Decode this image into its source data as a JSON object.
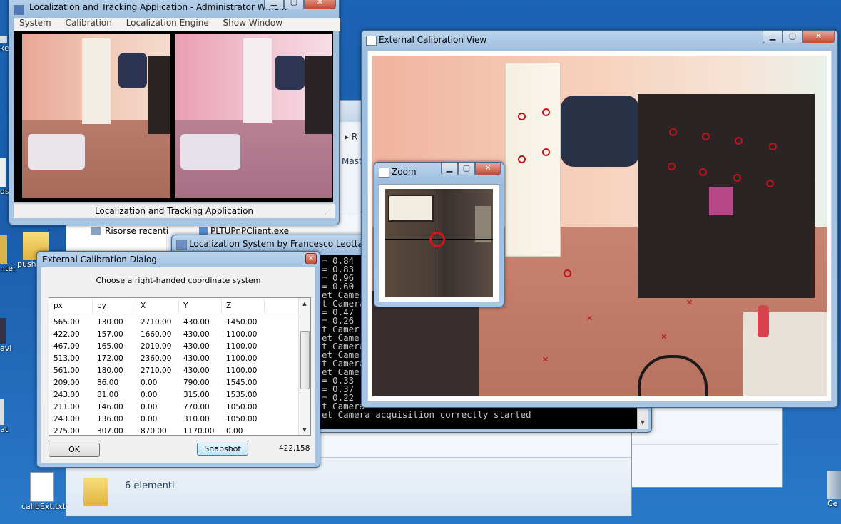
{
  "desktop": {
    "icons": [
      {
        "label": "ker"
      },
      {
        "label": "ds"
      },
      {
        "label": "nter"
      },
      {
        "label": "push"
      },
      {
        "label": "avi"
      },
      {
        "label": "at"
      },
      {
        "label": "calibExt.txt"
      },
      {
        "label": "Ce"
      }
    ]
  },
  "explorer": {
    "nav_item": "Risorse recenti",
    "file_item": "PLTUPnPClient.exe",
    "status_count": "6 elementi",
    "partial_labels": [
      "R",
      "Mast"
    ]
  },
  "main_window": {
    "title": "Localization and Tracking Application - Administrator Wind...",
    "menu": [
      "System",
      "Calibration",
      "Localization Engine",
      "Show Window"
    ],
    "status": "Localization and Tracking Application"
  },
  "console_window": {
    "title": "Localization System by Francesco Leotta 200",
    "lines": [
      "= 0.84",
      "= 0.83",
      "= 0.96",
      "= 0.60",
      "et Camer",
      "t Camera",
      "= 0.47",
      "= 0.26",
      "t Camer",
      "et Camer",
      "t Camera",
      "et Camer",
      "t Camera",
      "et Camer",
      "= 0.33",
      "= 0.37",
      "= 0.22",
      "t Camera",
      "et Camera acquisition correctly started"
    ]
  },
  "calib_view": {
    "title": "External Calibration View"
  },
  "zoom_window": {
    "title": "Zoom"
  },
  "dialog": {
    "title": "External Calibration Dialog",
    "instruction": "Choose a right-handed coordinate system",
    "columns": [
      "px",
      "py",
      "X",
      "Y",
      "Z"
    ],
    "rows": [
      [
        "565.00",
        "130.00",
        "2710.00",
        "430.00",
        "1450.00"
      ],
      [
        "422.00",
        "157.00",
        "1660.00",
        "430.00",
        "1100.00"
      ],
      [
        "467.00",
        "165.00",
        "2010.00",
        "430.00",
        "1100.00"
      ],
      [
        "513.00",
        "172.00",
        "2360.00",
        "430.00",
        "1100.00"
      ],
      [
        "561.00",
        "180.00",
        "2710.00",
        "430.00",
        "1100.00"
      ],
      [
        "209.00",
        "86.00",
        "0.00",
        "790.00",
        "1545.00"
      ],
      [
        "243.00",
        "81.00",
        "0.00",
        "315.00",
        "1535.00"
      ],
      [
        "211.00",
        "146.00",
        "0.00",
        "770.00",
        "1050.00"
      ],
      [
        "243.00",
        "136.00",
        "0.00",
        "310.00",
        "1050.00"
      ],
      [
        "275.00",
        "307.00",
        "870.00",
        "1170.00",
        "0.00"
      ]
    ],
    "ok_label": "OK",
    "snapshot_label": "Snapshot",
    "coords": "422,158"
  },
  "colors": {
    "desktop": "#1b63b3",
    "marker": "#c0141a",
    "title_glass": "#b9d3ec"
  }
}
